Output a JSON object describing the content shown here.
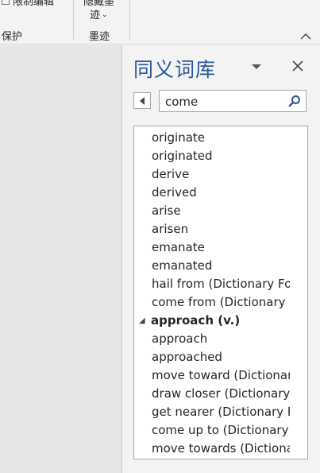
{
  "ribbon": {
    "protect_cmd": "限制编辑",
    "protect_group": "保护",
    "ink_line1": "隐藏墨",
    "ink_line2": "迹",
    "ink_group": "墨迹"
  },
  "thesaurus": {
    "title": "同义词库",
    "search_value": "come",
    "results": [
      {
        "type": "item",
        "text": "originate"
      },
      {
        "type": "item",
        "text": "originated"
      },
      {
        "type": "item",
        "text": "derive"
      },
      {
        "type": "item",
        "text": "derived"
      },
      {
        "type": "item",
        "text": "arise"
      },
      {
        "type": "item",
        "text": "arisen"
      },
      {
        "type": "item",
        "text": "emanate"
      },
      {
        "type": "item",
        "text": "emanated"
      },
      {
        "type": "item",
        "text": "hail from (Dictionary For"
      },
      {
        "type": "item",
        "text": "come from (Dictionary F"
      },
      {
        "type": "header",
        "text": "approach (v.)"
      },
      {
        "type": "item",
        "text": "approach"
      },
      {
        "type": "item",
        "text": "approached"
      },
      {
        "type": "item",
        "text": "move toward (Dictionary"
      },
      {
        "type": "item",
        "text": "draw closer (Dictionary I"
      },
      {
        "type": "item",
        "text": "get nearer (Dictionary Fo"
      },
      {
        "type": "item",
        "text": "come up to (Dictionary I"
      },
      {
        "type": "item",
        "text": "move towards (Dictiona"
      }
    ]
  },
  "colors": {
    "title_blue": "#2b579a",
    "pane_bg": "#f3f3f3",
    "doc_bg": "#e6e6e6"
  }
}
